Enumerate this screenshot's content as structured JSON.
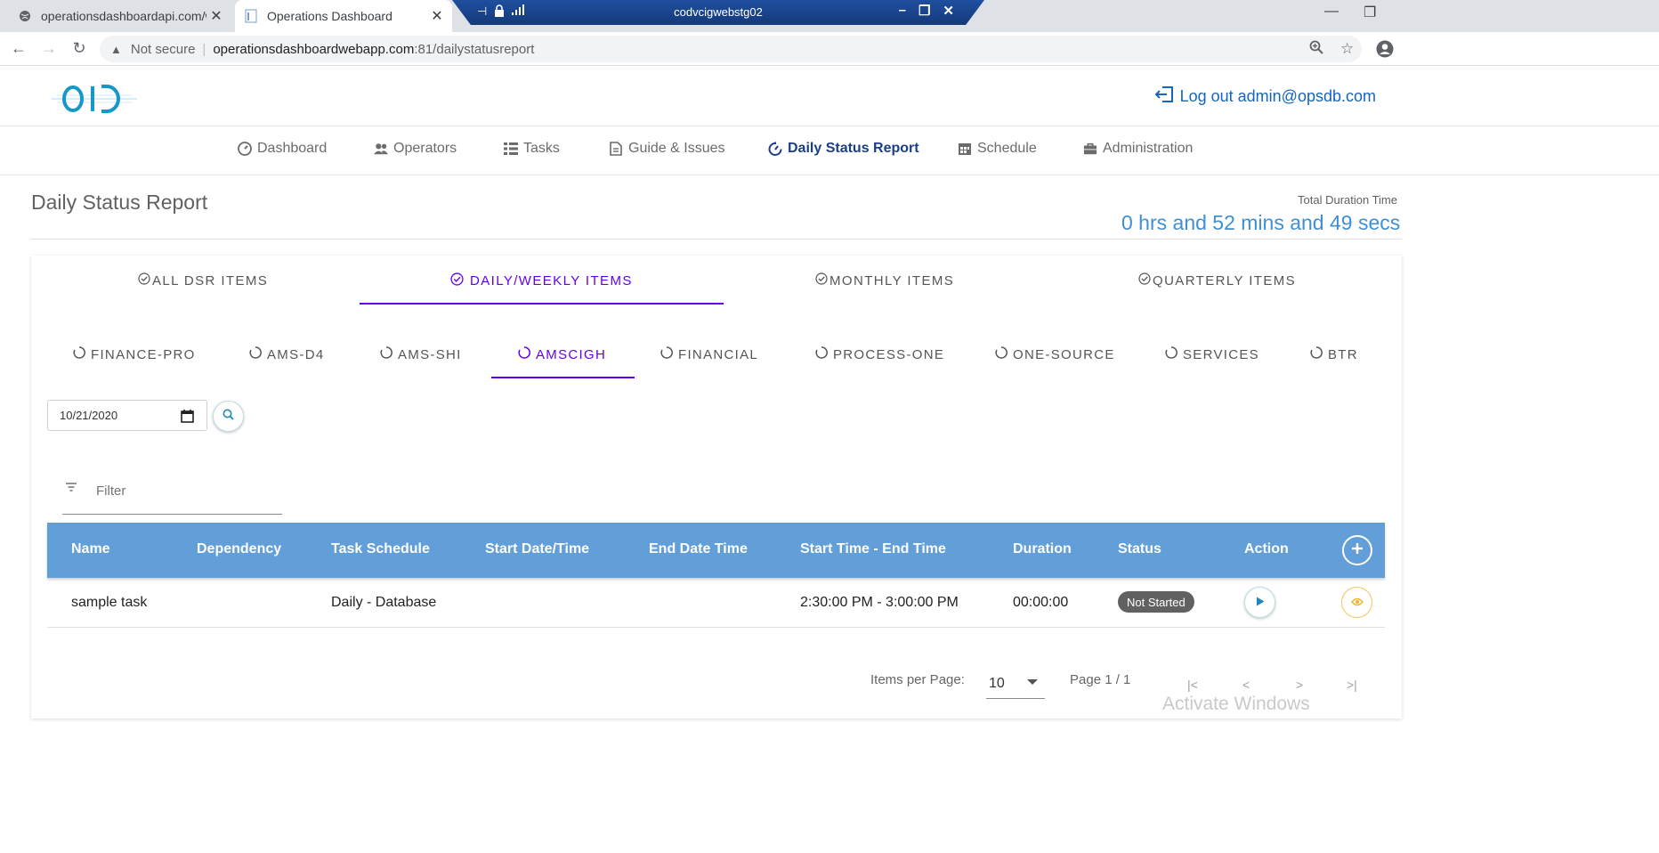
{
  "browser": {
    "tabs": [
      {
        "title": "operationsdashboardapi.com/we",
        "active": false
      },
      {
        "title": "Operations Dashboard",
        "active": true
      }
    ],
    "close_glyph": "✕",
    "rdp_title": "codvcigwebstg02",
    "address": {
      "security": "Not secure",
      "host": "operationsdashboardwebapp.com",
      "path": ":81/dailystatusreport"
    }
  },
  "header": {
    "logo_text": "OD",
    "logout_label": "Log out admin@opsdb.com"
  },
  "nav": {
    "items": [
      {
        "label": "Dashboard",
        "icon": "dashboard-icon"
      },
      {
        "label": "Operators",
        "icon": "people-icon"
      },
      {
        "label": "Tasks",
        "icon": "list-icon"
      },
      {
        "label": "Guide & Issues",
        "icon": "document-icon"
      },
      {
        "label": "Daily Status Report",
        "icon": "timer-icon"
      },
      {
        "label": "Schedule",
        "icon": "calendar-icon"
      },
      {
        "label": "Administration",
        "icon": "briefcase-icon"
      }
    ],
    "active_index": 4
  },
  "page": {
    "title": "Daily Status Report",
    "total_duration_label": "Total Duration Time",
    "total_duration_value": "0 hrs and 52 mins and 49 secs"
  },
  "category_tabs": [
    {
      "label": "ALL DSR ITEMS",
      "active": false
    },
    {
      "label": "DAILY/WEEKLY ITEMS",
      "active": true
    },
    {
      "label": "MONTHLY ITEMS",
      "active": false
    },
    {
      "label": "QUARTERLY ITEMS",
      "active": false
    }
  ],
  "sub_tabs": [
    {
      "label": "FINANCE-PRO",
      "active": false
    },
    {
      "label": "AMS-D4",
      "active": false
    },
    {
      "label": "AMS-SHI",
      "active": false
    },
    {
      "label": "AMSCIGH",
      "active": true
    },
    {
      "label": "FINANCIAL",
      "active": false
    },
    {
      "label": "PROCESS-ONE",
      "active": false
    },
    {
      "label": "ONE-SOURCE",
      "active": false
    },
    {
      "label": "SERVICES",
      "active": false
    },
    {
      "label": "BTR",
      "active": false
    }
  ],
  "date_filter": {
    "value": "10/21/2020"
  },
  "filter": {
    "placeholder": "Filter"
  },
  "table": {
    "columns": [
      "Name",
      "Dependency",
      "Task Schedule",
      "Start Date/Time",
      "End Date Time",
      "Start Time - End Time",
      "Duration",
      "Status",
      "Action"
    ],
    "rows": [
      {
        "name": "sample task",
        "dependency": "",
        "task_schedule": "Daily - Database",
        "start_date_time": "",
        "end_date_time": "",
        "start_end_time": "2:30:00 PM - 3:00:00 PM",
        "duration": "00:00:00",
        "status": "Not Started"
      }
    ]
  },
  "pagination": {
    "items_per_page_label": "Items per Page:",
    "items_per_page": "10",
    "page_label": "Page 1 / 1"
  },
  "watermark": "Activate Windows",
  "colors": {
    "accent_purple": "#6200ee",
    "table_header": "#629fd9",
    "link_blue": "#1565c0",
    "duration_blue": "#3f8fd2",
    "status_badge": "#616161"
  }
}
